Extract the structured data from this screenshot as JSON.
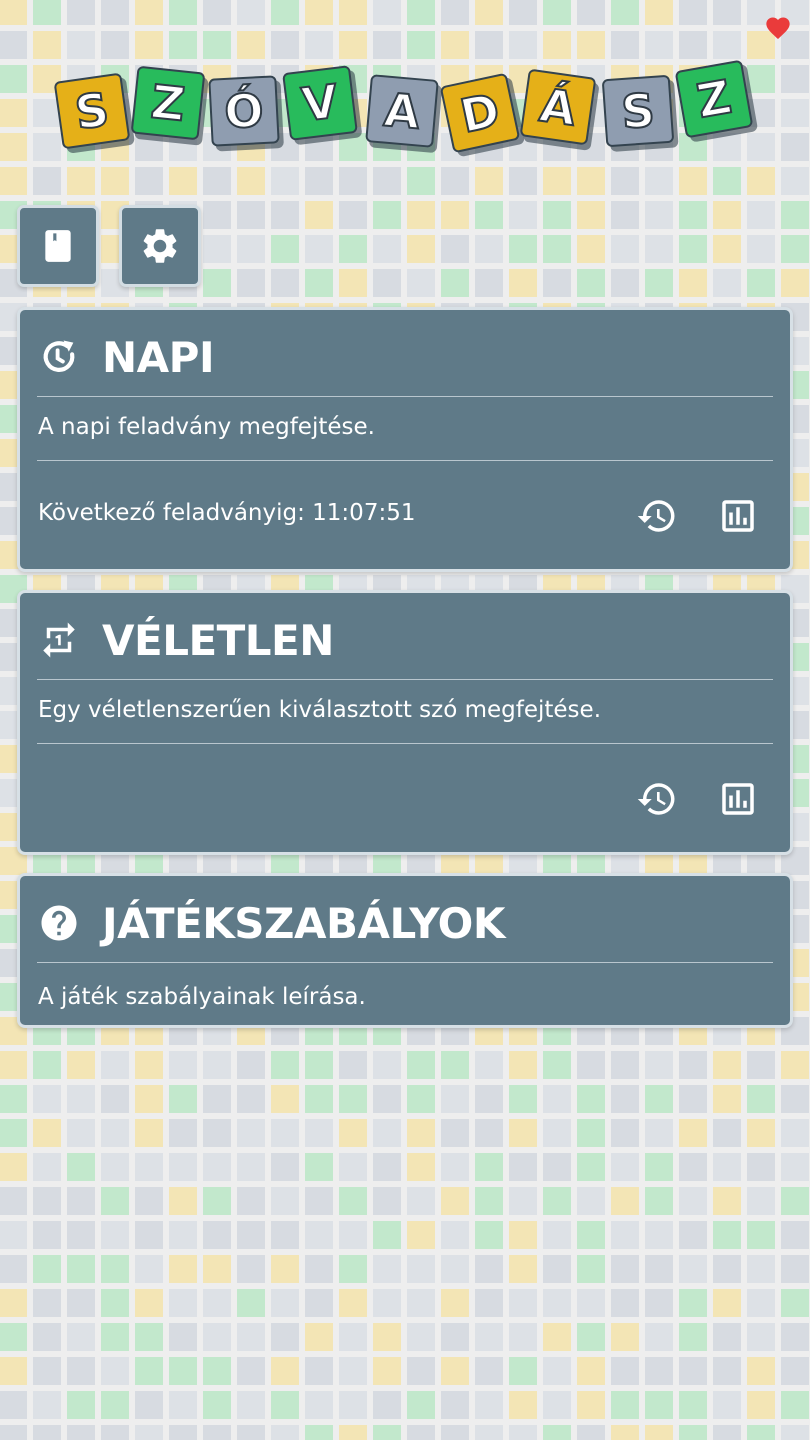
{
  "logo": {
    "letters": [
      {
        "char": "S",
        "color": "yellow"
      },
      {
        "char": "Z",
        "color": "green"
      },
      {
        "char": "Ó",
        "color": "gray"
      },
      {
        "char": "V",
        "color": "green"
      },
      {
        "char": "A",
        "color": "gray"
      },
      {
        "char": "D",
        "color": "yellow"
      },
      {
        "char": "Á",
        "color": "yellow"
      },
      {
        "char": "S",
        "color": "gray"
      },
      {
        "char": "Z",
        "color": "green"
      }
    ]
  },
  "icons": {
    "favorite": "heart-icon",
    "dictionary": "book-icon",
    "settings": "gear-icon"
  },
  "cards": {
    "daily": {
      "icon": "daily-refresh-icon",
      "title": "NAPI",
      "description": "A napi feladvány megfejtése.",
      "next_label": "Következő feladványig: 11:07:51"
    },
    "random": {
      "icon": "repeat-one-icon",
      "title": "VÉLETLEN",
      "description": "Egy véletlenszerűen kiválasztott szó megfejtése."
    },
    "rules": {
      "icon": "help-icon",
      "title": "JÁTÉKSZABÁLYOK",
      "description": "A játék szabályainak leírása."
    }
  },
  "colors": {
    "card_bg": "#5f7a88",
    "tile_yellow": "#e5b018",
    "tile_green": "#28bb5c",
    "tile_gray": "#8f9db0",
    "heart": "#ea3b3b"
  }
}
